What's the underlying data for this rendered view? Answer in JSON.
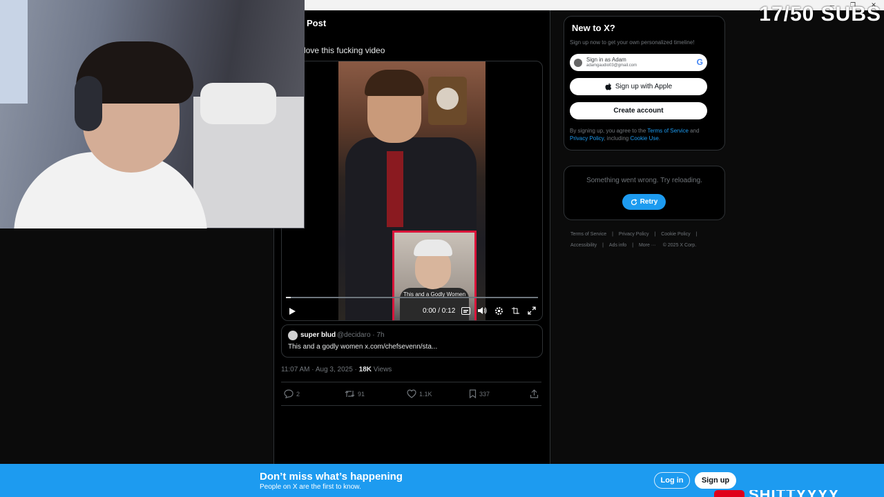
{
  "overlay": {
    "subs_counter": "17/50 SUBS",
    "corner_logo_text": "SHITTYYYY"
  },
  "window_controls": {
    "minimize": "─",
    "restore": "❐",
    "close": "✕"
  },
  "post": {
    "header": "Post",
    "text": "love this fucking video",
    "video": {
      "inset_caption": "This and a Godly Women",
      "time": "0:00 / 0:12",
      "progress_fraction": 0.02
    },
    "quote": {
      "name": "super blud",
      "handle_time": "@decidaro · 7h",
      "text": "This and a godly women x.com/chefsevenn/sta..."
    },
    "meta": {
      "time_date": "11:07 AM · Aug 3, 2025 · ",
      "views_count": "18K",
      "views_label": " Views"
    },
    "actions": {
      "replies": "2",
      "reposts": "91",
      "likes": "1.1K",
      "bookmarks": "337"
    }
  },
  "sidebar": {
    "new_to_x": {
      "title": "New to X?",
      "subtitle": "Sign up now to get your own personalized timeline!",
      "google_name": "Sign in as Adam",
      "google_email": "adamgaudio03@gmail.com",
      "apple_label": "Sign up with Apple",
      "create_label": "Create account",
      "terms_prefix": "By signing up, you agree to the ",
      "terms_link": "Terms of Service",
      "terms_and": " and ",
      "privacy_link": "Privacy Policy",
      "terms_including": ", including ",
      "cookie_link": "Cookie Use",
      "terms_end": "."
    },
    "error": {
      "message": "Something went wrong. Try reloading.",
      "retry_label": "Retry"
    },
    "footer": {
      "terms": "Terms of Service",
      "privacy": "Privacy Policy",
      "cookie": "Cookie Policy",
      "accessibility": "Accessibility",
      "ads": "Ads info",
      "more": "More ···",
      "copyright": "© 2025 X Corp."
    }
  },
  "banner": {
    "title": "Don’t miss what’s happening",
    "subtitle": "People on X are the first to know.",
    "login_label": "Log in",
    "signup_label": "Sign up"
  },
  "colors": {
    "accent": "#1d9bf0",
    "background": "#000000",
    "border": "#2f3336",
    "muted_text": "#71767b",
    "inset_border": "#d9143a"
  }
}
